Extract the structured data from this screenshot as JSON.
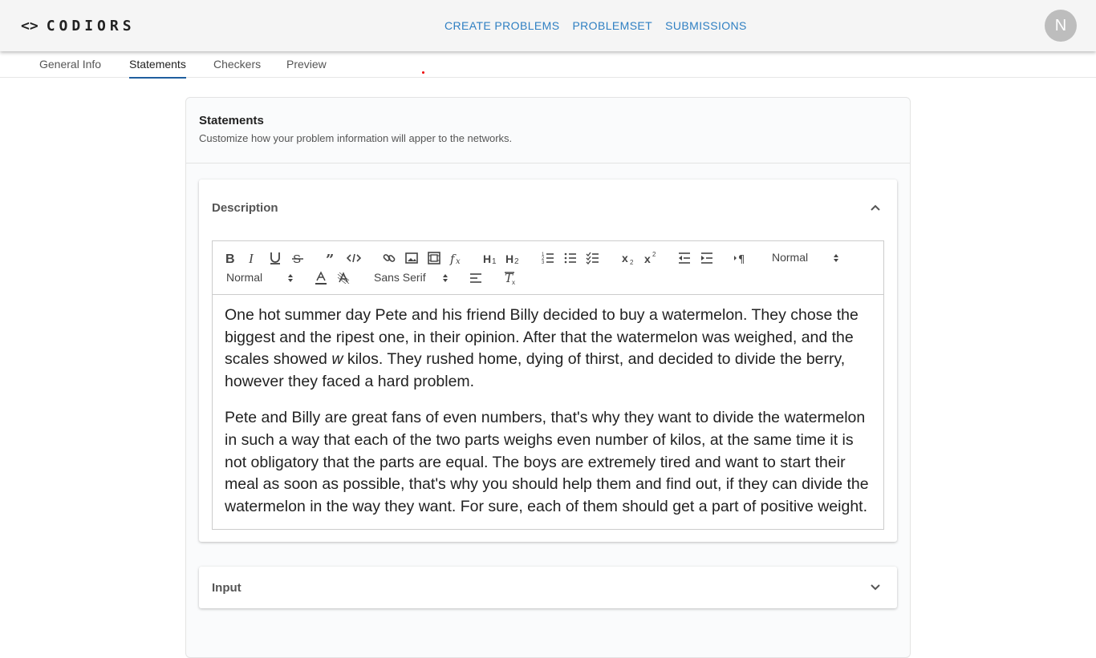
{
  "brand": {
    "brackets": "<>",
    "name": "CODIORS"
  },
  "topnav": [
    "CREATE PROBLEMS",
    "PROBLEMSET",
    "SUBMISSIONS"
  ],
  "avatar": {
    "initial": "N"
  },
  "subtabs": [
    "General Info",
    "Statements",
    "Checkers",
    "Preview"
  ],
  "active_subtab": "Statements",
  "card": {
    "title": "Statements",
    "subtitle": "Customize how your problem information will apper to the networks."
  },
  "description_panel": {
    "title": "Description",
    "toolbar": {
      "header_select": "Normal",
      "size_select": "Normal",
      "font_select": "Sans Serif",
      "icons": [
        "bold-icon",
        "italic-icon",
        "underline-icon",
        "strike-icon",
        "blockquote-icon",
        "code-block-icon",
        "link-icon",
        "image-icon",
        "video-icon",
        "formula-icon",
        "h1-icon",
        "h2-icon",
        "ordered-list-icon",
        "bullet-list-icon",
        "check-list-icon",
        "subscript-icon",
        "superscript-icon",
        "outdent-icon",
        "indent-icon",
        "rtl-icon",
        "text-color-icon",
        "background-color-icon",
        "align-icon",
        "clear-format-icon"
      ]
    },
    "paragraph1_before": "One hot summer day Pete and his friend Billy decided to buy a watermelon. They chose the biggest and the ripest one, in their opinion. After that the watermelon was weighed, and the scales showed ",
    "paragraph1_var": "w",
    "paragraph1_after": " kilos. They rushed home, dying of thirst, and decided to divide the berry, however they faced a hard problem.",
    "paragraph2": "Pete and Billy are great fans of even numbers, that's why they want to divide the watermelon in such a way that each of the two parts weighs even number of kilos, at the same time it is not obligatory that the parts are equal. The boys are extremely tired and want to start their meal as soon as possible, that's why you should help them and find out, if they can divide the watermelon in the way they want. For sure, each of them should get a part of positive weight."
  },
  "input_panel": {
    "title": "Input"
  },
  "colors": {
    "link": "#2e7fc2",
    "tab_underline": "#1f5f9e",
    "appbar": "#f5f5f5"
  }
}
